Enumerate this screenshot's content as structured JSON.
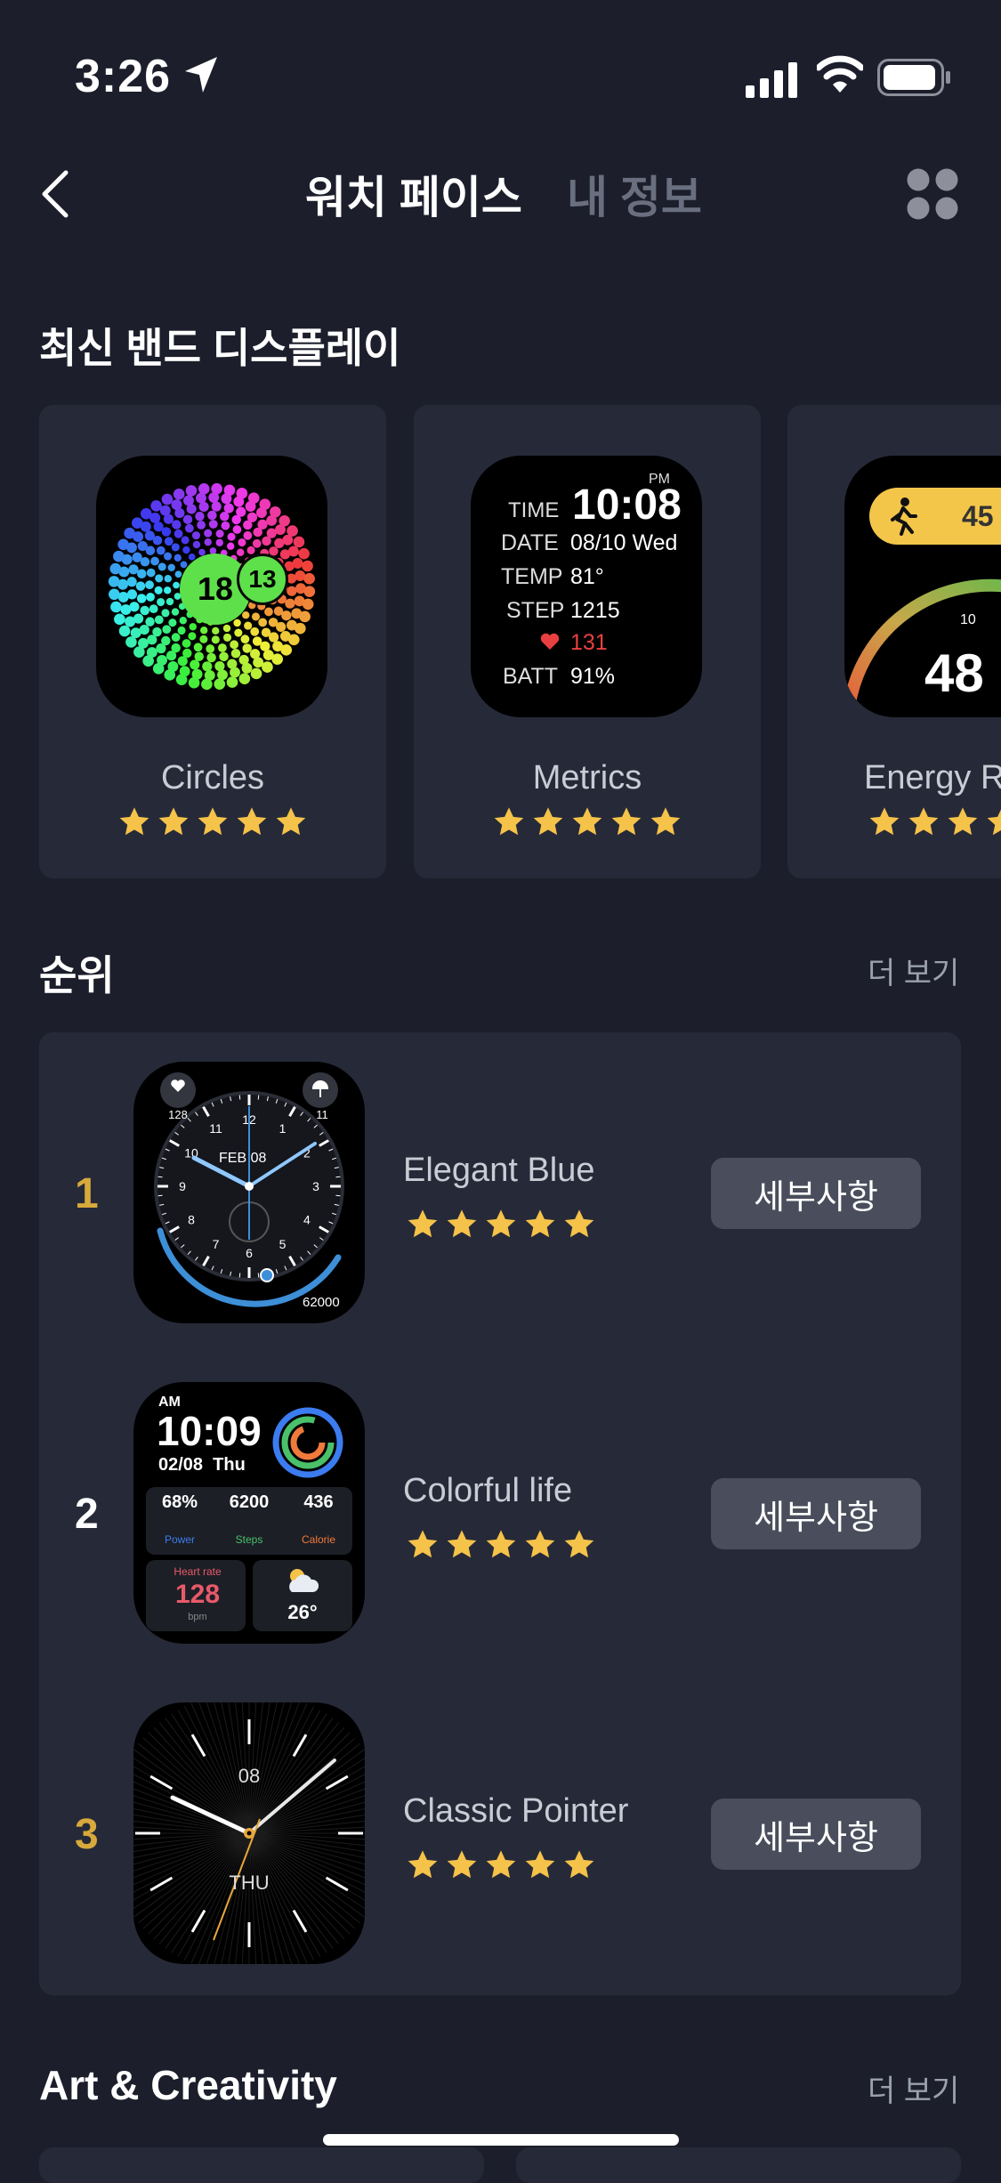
{
  "status": {
    "time": "3:26"
  },
  "nav": {
    "tabs": [
      "워치 페이스",
      "내 정보"
    ]
  },
  "latest": {
    "title": "최신 밴드 디스플레이",
    "items": [
      {
        "name": "Circles",
        "rating": 5,
        "face": {
          "big": "18",
          "small": "13"
        }
      },
      {
        "name": "Metrics",
        "rating": 5,
        "face": {
          "ampm": "PM",
          "time_label": "TIME",
          "time": "10:08",
          "date_label": "DATE",
          "date": "08/10 Wed",
          "temp_label": "TEMP",
          "temp": "81°",
          "step_label": "STEP",
          "step": "1215",
          "heart": "131",
          "batt_label": "BATT",
          "batt": "91%"
        }
      },
      {
        "name": "Energy R",
        "rating": 5,
        "face": {
          "steps": "45",
          "big": "48",
          "tick": "10"
        }
      }
    ]
  },
  "ranking": {
    "title": "순위",
    "more": "더 보기",
    "items": [
      {
        "rank": "1",
        "name": "Elegant Blue",
        "rating": 5,
        "button": "세부사항",
        "face": {
          "heart": "128",
          "rain": "11",
          "date": "FEB 08",
          "steps": "62000",
          "numbers": [
            "12",
            "1",
            "2",
            "3",
            "4",
            "5",
            "6",
            "7",
            "8",
            "9",
            "10",
            "11"
          ]
        }
      },
      {
        "rank": "2",
        "name": "Colorful life",
        "rating": 5,
        "button": "세부사항",
        "face": {
          "ampm": "AM",
          "time": "10:09",
          "date": "02/08  Thu",
          "power": "68%",
          "power_label": "Power",
          "steps": "6200",
          "steps_label": "Steps",
          "calorie": "436",
          "calorie_label": "Calorie",
          "hr_label": "Heart rate",
          "hr": "128",
          "hr_unit": "bpm",
          "temp": "26°"
        }
      },
      {
        "rank": "3",
        "name": "Classic Pointer",
        "rating": 5,
        "button": "세부사항",
        "face": {
          "date": "08",
          "day": "THU"
        }
      }
    ]
  },
  "art": {
    "title": "Art & Creativity",
    "more": "더 보기"
  },
  "colors": {
    "bg": "#1c1f2b",
    "card": "#262a38",
    "star": "#f5c24a",
    "gold_rank": "#d8a93b",
    "button": "#4a4e5c"
  },
  "icons": [
    "location-arrow-icon",
    "signal-icon",
    "wifi-icon",
    "battery-icon",
    "back-chevron-icon",
    "grid-icon",
    "star-icon"
  ]
}
